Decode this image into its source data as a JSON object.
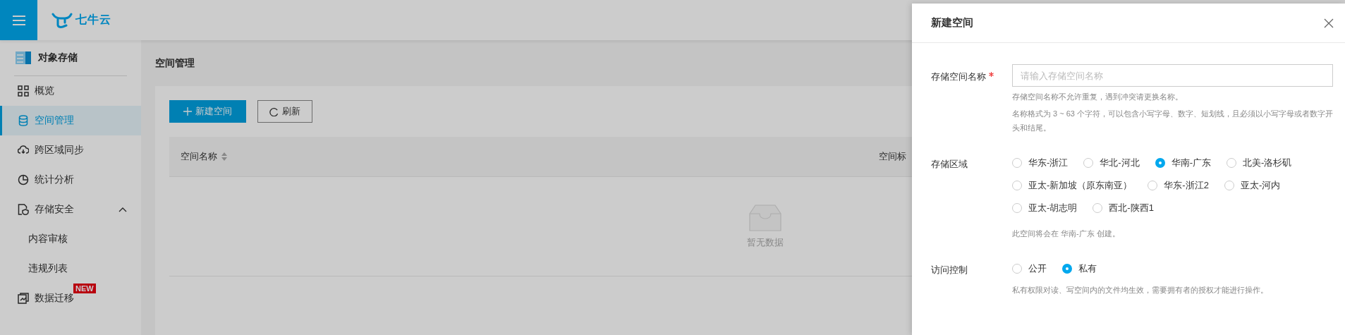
{
  "header": {
    "logo": "七牛云"
  },
  "sidebar": {
    "product": "对象存储",
    "items": [
      {
        "label": "概览",
        "selected": false
      },
      {
        "label": "空间管理",
        "selected": true
      },
      {
        "label": "跨区域同步",
        "selected": false
      },
      {
        "label": "统计分析",
        "selected": false
      },
      {
        "label": "存储安全",
        "selected": false,
        "expanded": true,
        "children": [
          {
            "label": "内容审核",
            "selected": false
          },
          {
            "label": "违规列表",
            "selected": false
          }
        ]
      },
      {
        "label": "数据迁移",
        "selected": false,
        "badge": "NEW"
      }
    ]
  },
  "main": {
    "title": "空间管理",
    "buttons": [
      {
        "label": "新建空间",
        "kind": "primary"
      },
      {
        "label": "刷新",
        "kind": "refresh"
      }
    ],
    "table": {
      "columns": [
        {
          "label": "空间名称",
          "sortable": true
        },
        {
          "label": "空间标",
          "sortable": false
        }
      ],
      "empty_text": "暂无数据"
    }
  },
  "drawer": {
    "title": "新建空间",
    "name_field": {
      "label": "存储空间名称",
      "required": true,
      "placeholder": "请输入存储空间名称",
      "help": [
        "存储空间名称不允许重复，遇到冲突请更换名称。",
        "名称格式为 3 ~ 63 个字符，可以包含小写字母、数字、短划线，且必须以小写字母或者数字开头和结尾。"
      ]
    },
    "region": {
      "label": "存储区域",
      "options": [
        {
          "label": "华东-浙江",
          "selected": false
        },
        {
          "label": "华北-河北",
          "selected": false
        },
        {
          "label": "华南-广东",
          "selected": true
        },
        {
          "label": "北美-洛杉矶",
          "selected": false
        },
        {
          "label": "亚太-新加坡（原东南亚）",
          "selected": false
        },
        {
          "label": "华东-浙江2",
          "selected": false
        },
        {
          "label": "亚太-河内",
          "selected": false
        },
        {
          "label": "亚太-胡志明",
          "selected": false
        },
        {
          "label": "西北-陕西1",
          "selected": false
        }
      ],
      "note": "此空间将会在 华南-广东 创建。"
    },
    "access": {
      "label": "访问控制",
      "options": [
        {
          "label": "公开",
          "selected": false
        },
        {
          "label": "私有",
          "selected": true
        }
      ],
      "note": "私有权限对读、写空间内的文件均生效，需要拥有者的授权才能进行操作。"
    }
  }
}
